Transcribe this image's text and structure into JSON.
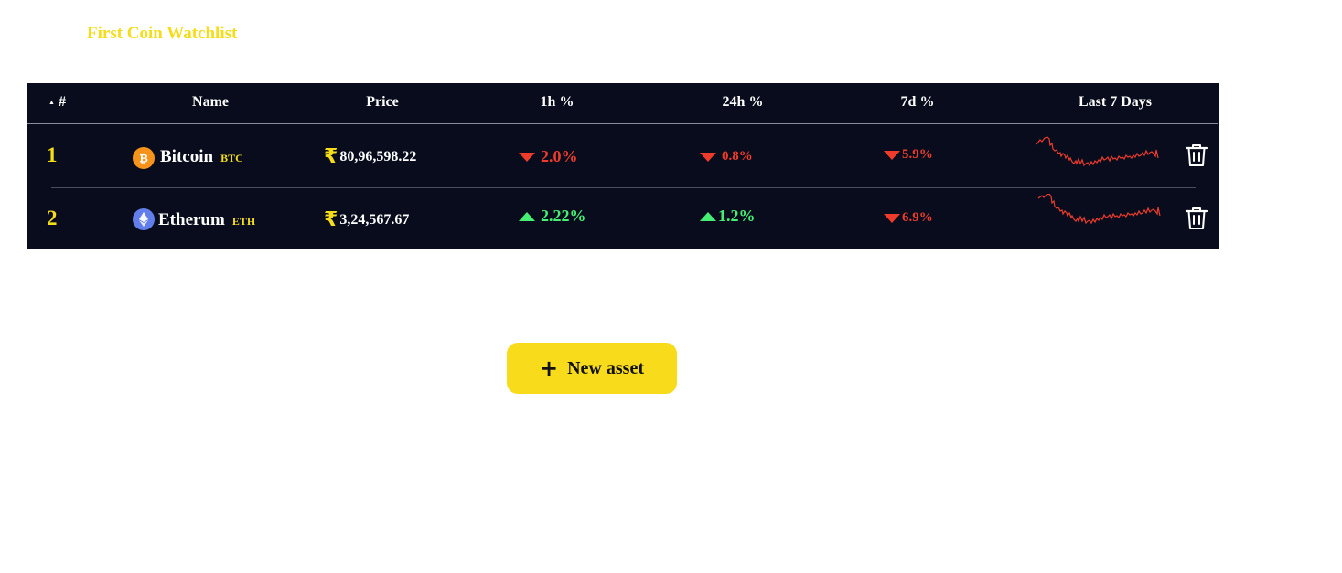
{
  "page": {
    "title": "First Coin Watchlist"
  },
  "table": {
    "columns": {
      "rank": "#",
      "name": "Name",
      "price": "Price",
      "change_1h": "1h %",
      "change_24h": "24h %",
      "change_7d": "7d %",
      "sparkline": "Last 7 Days"
    },
    "sort": {
      "column": "rank",
      "direction": "ascending",
      "icon": "sort-up-icon"
    },
    "rows": [
      {
        "rank": "1",
        "name": "Bitcoin",
        "symbol": "BTC",
        "icon": "bitcoin-icon",
        "icon_color": "#f7931a",
        "currency_symbol": "₹",
        "price": "80,96,598.22",
        "change_1h": "2.0%",
        "change_1h_dir": "down",
        "change_24h": "0.8%",
        "change_24h_dir": "down",
        "change_7d": "5.9%",
        "change_7d_dir": "down"
      },
      {
        "rank": "2",
        "name": "Etherum",
        "symbol": "ETH",
        "icon": "ethereum-icon",
        "icon_color": "#627eea",
        "currency_symbol": "₹",
        "price": "3,24,567.67",
        "change_1h": "2.22%",
        "change_1h_dir": "up",
        "change_24h": "1.2%",
        "change_24h_dir": "up",
        "change_7d": "6.9%",
        "change_7d_dir": "down"
      }
    ]
  },
  "actions": {
    "new_asset_label": "New asset",
    "new_asset_icon": "plus-icon"
  },
  "colors": {
    "accent": "#f5dd1a",
    "table_bg": "#080c1c",
    "negative": "#ef3b2c",
    "positive": "#46ef74",
    "sparkline": "#ef3b2c"
  }
}
